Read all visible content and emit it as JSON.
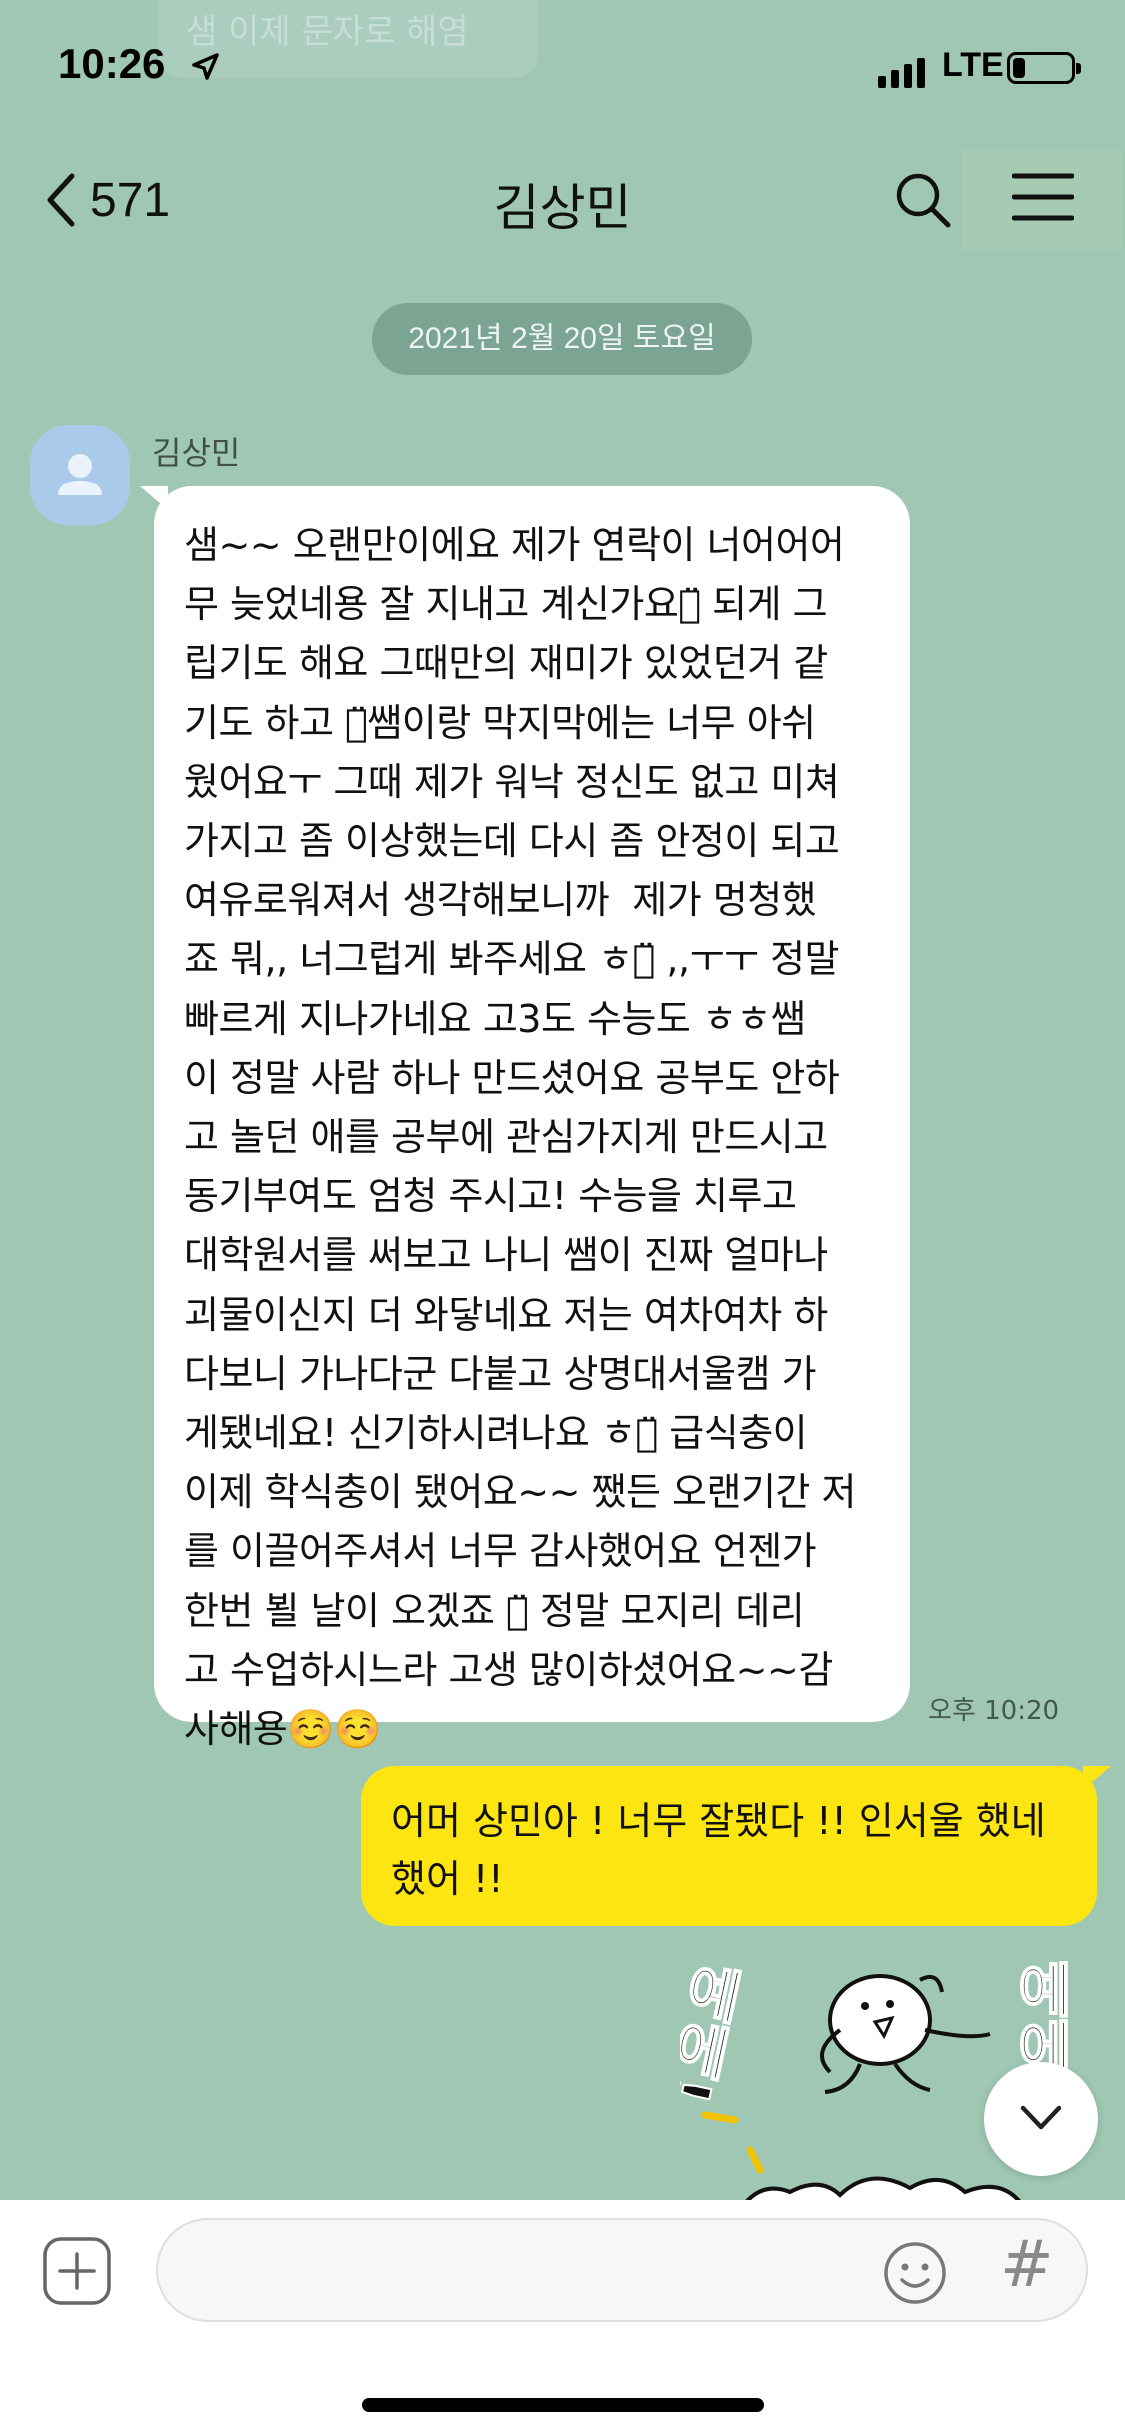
{
  "status_bar": {
    "time": "10:26",
    "network": "LTE",
    "battery_level": 0.22
  },
  "ghost_banner": {
    "text": "샘 이제 문자로 해염"
  },
  "nav": {
    "back_count": "571",
    "title": "김상민"
  },
  "chat": {
    "date": "2021년 2월 20일 토요일",
    "received": {
      "sender": "김상민",
      "text": "샘~~ 오랜만이에요 제가 연락이 너어어어\n무 늦었네용 잘 지내고 계신가요ㅎ̈ 되게 그\n립기도 해요 그때만의 재미가 있었던거 같\n기도 하고 ㅎ̈쌤이랑 막지막에는 너무 아쉬\n웠어요ㅜ 그때 제가 워낙 정신도 없고 미쳐\n가지고 좀 이상했는데 다시 좀 안정이 되고\n여유로워져서 생각해보니까  제가 멍청했\n죠 뭐,, 너그럽게 봐주세요 ㅎㅎ̈ ,,ㅜㅜ 정말\n빠르게 지나가네요 고3도 수능도 ㅎㅎ쌤\n이 정말 사람 하나 만드셨어요 공부도 안하\n고 놀던 애를 공부에 관심가지게 만드시고\n동기부여도 엄청 주시고! 수능을 치루고\n대학원서를 써보고 나니 쌤이 진짜 얼마나\n괴물이신지 더 와닿네요 저는 여차여차 하\n다보니 가나다군 다붙고 상명대서울캠 가\n게됐네요! 신기하시려나요 ㅎㅎ̈ 급식충이\n이제 학식충이 됐어요~~ 쨌든 오랜기간 저\n를 이끌어주셔서 너무 감사했어요 언젠가\n한번 뵐 날이 오겠죠 ㅎ̈ 정말 모지리 데리\n고 수업하시느라 고생 많이하셨어요~~감\n사해용☺️☺️",
      "time": "오후 10:20"
    },
    "sent": {
      "text": "어머 상민아 ! 너무 잘됐다 !! 인서울 했네\n했어 !!"
    },
    "sticker": {
      "text_left": "예에!",
      "text_right": "예에"
    }
  },
  "composer": {
    "placeholder": "",
    "hash_label": "#"
  },
  "colors": {
    "background": "#9fc7b4",
    "sent_bubble": "#fde512",
    "received_bubble": "#ffffff"
  }
}
